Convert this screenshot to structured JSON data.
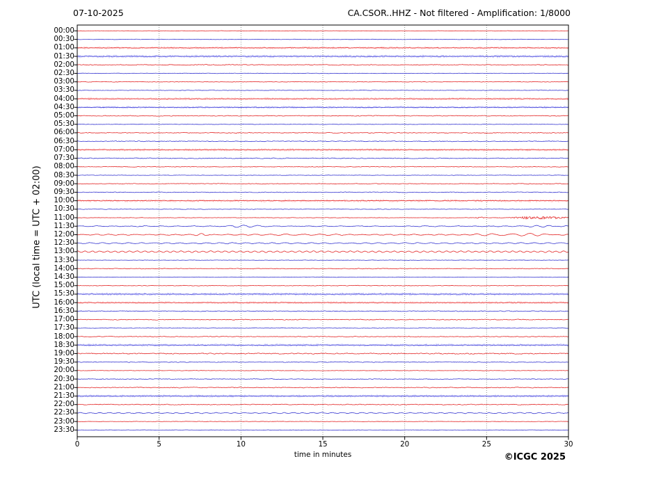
{
  "footer": {
    "copyright": "©ICGC 2025"
  },
  "chart_data": {
    "type": "line",
    "subtype": "helicorder-day-plot",
    "title_left": "07-10-2025",
    "title_right": "CA.CSOR..HHZ - Not filtered - Amplification: 1/8000",
    "xlabel": "time in minutes",
    "ylabel": "UTC (local time = UTC + 02:00)",
    "xlim": [
      0,
      30
    ],
    "x_ticks": [
      0,
      5,
      10,
      15,
      20,
      25,
      30
    ],
    "minutes_per_row": 30,
    "grid": "vertical dotted gridlines at 5-minute intervals",
    "legend": "red trace = hh:00 half-hour, blue trace = hh:30 half-hour",
    "colors": {
      "trace_red_core": "#e01010",
      "trace_red_band": "#ff9999",
      "trace_blue_core": "#2222cc",
      "trace_blue_band": "#9999ff",
      "grid": "#8a8a8a",
      "frame": "#000000"
    },
    "rows": [
      {
        "time": "00:00",
        "color": "red",
        "noise": 0.5
      },
      {
        "time": "00:30",
        "color": "blue",
        "noise": 0.5
      },
      {
        "time": "01:00",
        "color": "red",
        "noise": 1.6
      },
      {
        "time": "01:30",
        "color": "blue",
        "noise": 1.8
      },
      {
        "time": "02:00",
        "color": "red",
        "noise": 1.0
      },
      {
        "time": "02:30",
        "color": "blue",
        "noise": 0.55
      },
      {
        "time": "03:00",
        "color": "red",
        "noise": 0.65
      },
      {
        "time": "03:30",
        "color": "blue",
        "noise": 0.55
      },
      {
        "time": "04:00",
        "color": "red",
        "noise": 1.6
      },
      {
        "time": "04:30",
        "color": "blue",
        "noise": 1.5
      },
      {
        "time": "05:00",
        "color": "red",
        "noise": 0.9
      },
      {
        "time": "05:30",
        "color": "blue",
        "noise": 0.55
      },
      {
        "time": "06:00",
        "color": "red",
        "noise": 0.9
      },
      {
        "time": "06:30",
        "color": "blue",
        "noise": 0.9
      },
      {
        "time": "07:00",
        "color": "red",
        "noise": 1.7
      },
      {
        "time": "07:30",
        "color": "blue",
        "noise": 1.0
      },
      {
        "time": "08:00",
        "color": "red",
        "noise": 0.7
      },
      {
        "time": "08:30",
        "color": "blue",
        "noise": 0.5
      },
      {
        "time": "09:00",
        "color": "red",
        "noise": 0.8
      },
      {
        "time": "09:30",
        "color": "blue",
        "noise": 0.8
      },
      {
        "time": "10:00",
        "color": "red",
        "noise": 1.8
      },
      {
        "time": "10:30",
        "color": "blue",
        "noise": 0.6
      },
      {
        "time": "11:00",
        "color": "red",
        "noise": 0.5,
        "events": [
          {
            "type": "burst",
            "start": 24.3,
            "end": 24.9,
            "amp": 1.1
          },
          {
            "type": "burst",
            "start": 26.3,
            "end": 30,
            "amp": 1.4
          }
        ]
      },
      {
        "time": "11:30",
        "color": "blue",
        "noise": 0.6,
        "wave": {
          "amp": 0.4,
          "period": 1.0
        },
        "events": [
          {
            "type": "wave",
            "start": 8.5,
            "end": 11.8,
            "amp": 1.2,
            "period": 0.8
          },
          {
            "type": "wave",
            "start": 27.3,
            "end": 29.5,
            "amp": 1.1,
            "period": 0.7
          }
        ]
      },
      {
        "time": "12:00",
        "color": "red",
        "noise": 0.55,
        "wave": {
          "amp": 0.55,
          "period": 0.8
        },
        "events": [
          {
            "type": "wave",
            "start": 7.0,
            "end": 8.2,
            "amp": 1.0,
            "period": 0.6
          },
          {
            "type": "wave",
            "start": 11.0,
            "end": 16.5,
            "amp": 1.2,
            "period": 0.95
          },
          {
            "type": "wave",
            "start": 23.3,
            "end": 30,
            "amp": 1.5,
            "period": 1.1
          }
        ]
      },
      {
        "time": "12:30",
        "color": "blue",
        "noise": 0.55,
        "wave": {
          "amp": 0.65,
          "period": 0.8
        }
      },
      {
        "time": "13:00",
        "color": "red",
        "noise": 0.5,
        "wave": {
          "amp": 0.95,
          "period": 0.45
        }
      },
      {
        "time": "13:30",
        "color": "blue",
        "noise": 0.5
      },
      {
        "time": "14:00",
        "color": "red",
        "noise": 0.8
      },
      {
        "time": "14:30",
        "color": "blue",
        "noise": 0.5
      },
      {
        "time": "15:00",
        "color": "red",
        "noise": 0.65
      },
      {
        "time": "15:30",
        "color": "blue",
        "noise": 1.8
      },
      {
        "time": "16:00",
        "color": "red",
        "noise": 1.5
      },
      {
        "time": "16:30",
        "color": "blue",
        "noise": 0.9
      },
      {
        "time": "17:00",
        "color": "red",
        "noise": 0.9
      },
      {
        "time": "17:30",
        "color": "blue",
        "noise": 0.55
      },
      {
        "time": "18:00",
        "color": "red",
        "noise": 0.8
      },
      {
        "time": "18:30",
        "color": "blue",
        "noise": 1.7
      },
      {
        "time": "19:00",
        "color": "red",
        "noise": 1.2
      },
      {
        "time": "19:30",
        "color": "blue",
        "noise": 0.9
      },
      {
        "time": "20:00",
        "color": "red",
        "noise": 0.5
      },
      {
        "time": "20:30",
        "color": "blue",
        "noise": 0.8
      },
      {
        "time": "21:00",
        "color": "red",
        "noise": 0.9
      },
      {
        "time": "21:30",
        "color": "blue",
        "noise": 1.7
      },
      {
        "time": "22:00",
        "color": "red",
        "noise": 0.9
      },
      {
        "time": "22:30",
        "color": "blue",
        "noise": 0.65,
        "wave": {
          "amp": 0.55,
          "period": 0.6
        }
      },
      {
        "time": "23:00",
        "color": "red",
        "noise": 0.5
      },
      {
        "time": "23:30",
        "color": "blue",
        "noise": 0.5
      }
    ]
  }
}
